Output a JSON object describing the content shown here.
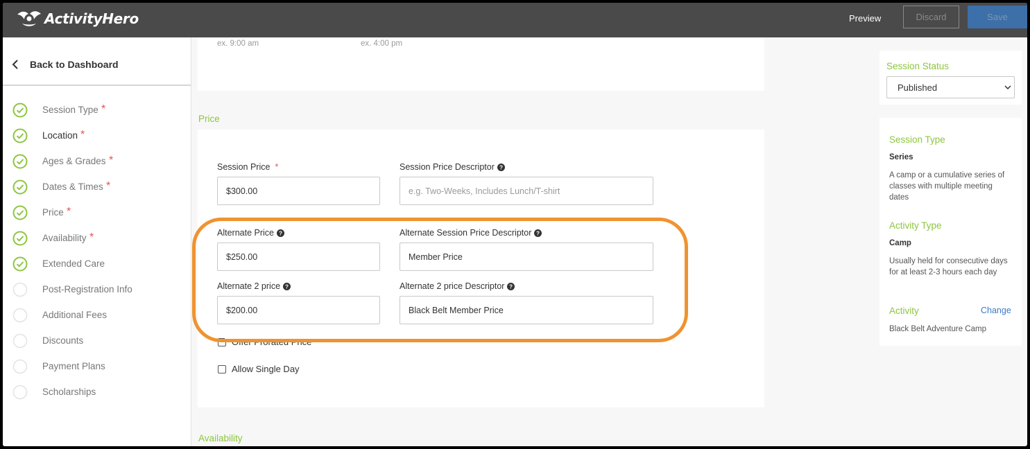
{
  "header": {
    "brand": "ActivityHero",
    "preview_label": "Preview",
    "discard_label": "Discard",
    "save_label": "Save"
  },
  "sidebar": {
    "back_label": "Back to Dashboard",
    "items": [
      {
        "label": "Session Type",
        "required": "*",
        "complete": true
      },
      {
        "label": "Location",
        "required": "*",
        "complete": true
      },
      {
        "label": "Ages & Grades",
        "required": "*",
        "complete": true
      },
      {
        "label": "Dates & Times",
        "required": "*",
        "complete": true
      },
      {
        "label": "Price",
        "required": "*",
        "complete": true
      },
      {
        "label": "Availability",
        "required": "*",
        "complete": true
      },
      {
        "label": "Extended Care",
        "required": "",
        "complete": true
      },
      {
        "label": "Post-Registration Info",
        "required": "",
        "complete": false
      },
      {
        "label": "Additional Fees",
        "required": "",
        "complete": false
      },
      {
        "label": "Discounts",
        "required": "",
        "complete": false
      },
      {
        "label": "Payment Plans",
        "required": "",
        "complete": false
      },
      {
        "label": "Scholarships",
        "required": "",
        "complete": false
      }
    ]
  },
  "times": {
    "start_hint": "ex. 9:00 am",
    "end_hint": "ex. 4:00 pm"
  },
  "price": {
    "section_title": "Price",
    "session_price_label": "Session Price",
    "session_price_required": "*",
    "session_price_value": "$300.00",
    "descriptor_label": "Session Price Descriptor",
    "descriptor_placeholder": "e.g. Two-Weeks, Includes Lunch/T-shirt",
    "alt_price_label": "Alternate Price",
    "alt_price_value": "$250.00",
    "alt_descriptor_label": "Alternate Session Price Descriptor",
    "alt_descriptor_value": "Member Price",
    "alt2_price_label": "Alternate 2 price",
    "alt2_price_value": "$200.00",
    "alt2_descriptor_label": "Alternate 2 price Descriptor",
    "alt2_descriptor_value": "Black Belt Member Price",
    "prorated_label": "Offer Prorated Price",
    "single_day_label": "Allow Single Day"
  },
  "availability": {
    "section_title": "Availability"
  },
  "status": {
    "title": "Session Status",
    "selected": "Published"
  },
  "info": {
    "session_type_title": "Session Type",
    "session_type_value": "Series",
    "session_type_desc": "A camp or a cumulative series of classes with multiple meeting dates",
    "activity_type_title": "Activity Type",
    "activity_type_value": "Camp",
    "activity_type_desc": "Usually held for consecutive days for at least 2-3 hours each day",
    "activity_title": "Activity",
    "change_label": "Change",
    "activity_value": "Black Belt Adventure Camp"
  },
  "colors": {
    "accent_green": "#8cc63f",
    "highlight_orange": "#ef9330",
    "link_blue": "#3d7bc6",
    "topbar": "#4a4a4a"
  }
}
